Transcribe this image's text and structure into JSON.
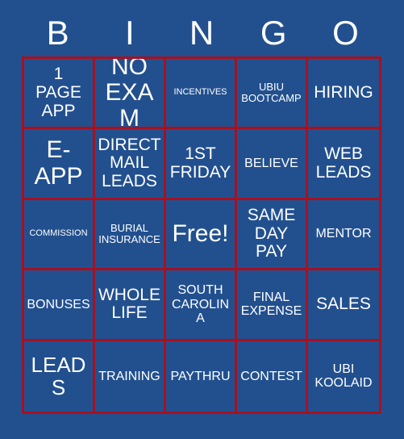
{
  "card": {
    "background_color": "#22508F",
    "border_color": "#A81020",
    "text_color": "#FFFFFF"
  },
  "header": {
    "letters": [
      "B",
      "I",
      "N",
      "G",
      "O"
    ]
  },
  "grid": {
    "rows": 5,
    "columns": 5,
    "cells": [
      {
        "text": "1\nPAGE\nAPP",
        "size": "fs-md",
        "free": false
      },
      {
        "text": "NO\nEXAM",
        "size": "fs-xl",
        "free": false
      },
      {
        "text": "INCENTIVES",
        "size": "fs-xxs",
        "free": false
      },
      {
        "text": "UBIU\nBOOTCAMP",
        "size": "fs-xs",
        "free": false
      },
      {
        "text": "HIRING",
        "size": "fs-md",
        "free": false
      },
      {
        "text": "E-\nAPP",
        "size": "fs-xl",
        "free": false
      },
      {
        "text": "DIRECT\nMAIL\nLEADS",
        "size": "fs-md",
        "free": false
      },
      {
        "text": "1ST\nFRIDAY",
        "size": "fs-md",
        "free": false
      },
      {
        "text": "BELIEVE",
        "size": "fs-sm",
        "free": false
      },
      {
        "text": "WEB\nLEADS",
        "size": "fs-md",
        "free": false
      },
      {
        "text": "COMMISSION",
        "size": "fs-xxs",
        "free": false
      },
      {
        "text": "BURIAL\nINSURANCE",
        "size": "fs-xs",
        "free": false
      },
      {
        "text": "Free!",
        "size": "fs-free",
        "free": true
      },
      {
        "text": "SAME\nDAY\nPAY",
        "size": "fs-md",
        "free": false
      },
      {
        "text": "MENTOR",
        "size": "fs-sm",
        "free": false
      },
      {
        "text": "BONUSES",
        "size": "fs-sm",
        "free": false
      },
      {
        "text": "WHOLE\nLIFE",
        "size": "fs-md",
        "free": false
      },
      {
        "text": "SOUTH\nCAROLINA",
        "size": "fs-sm",
        "free": false
      },
      {
        "text": "FINAL\nEXPENSE",
        "size": "fs-sm",
        "free": false
      },
      {
        "text": "SALES",
        "size": "fs-md",
        "free": false
      },
      {
        "text": "LEADS",
        "size": "fs-lg",
        "free": false
      },
      {
        "text": "TRAINING",
        "size": "fs-sm",
        "free": false
      },
      {
        "text": "PAYTHRU",
        "size": "fs-sm",
        "free": false
      },
      {
        "text": "CONTEST",
        "size": "fs-sm",
        "free": false
      },
      {
        "text": "UBI\nKOOLAID",
        "size": "fs-sm",
        "free": false
      }
    ]
  }
}
